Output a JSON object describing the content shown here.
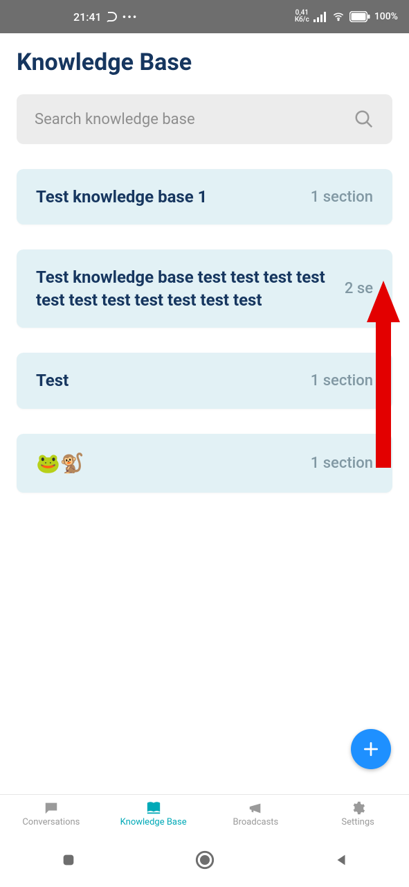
{
  "status": {
    "time": "21:41",
    "kbps_top": "0,41",
    "kbps_bottom": "Кб/с",
    "battery": "100%"
  },
  "header": {
    "title": "Knowledge Base"
  },
  "search": {
    "placeholder": "Search knowledge base"
  },
  "items": [
    {
      "title": "Test knowledge base 1",
      "count": "1 section"
    },
    {
      "title": "Test knowledge base test test test test test test test test test test test",
      "count": "2 se"
    },
    {
      "title": "Test",
      "count": "1 section"
    },
    {
      "title": "🐸🐒",
      "count": "1 section"
    }
  ],
  "tabs": {
    "conversations": "Conversations",
    "kb": "Knowledge Base",
    "broadcasts": "Broadcasts",
    "settings": "Settings"
  }
}
